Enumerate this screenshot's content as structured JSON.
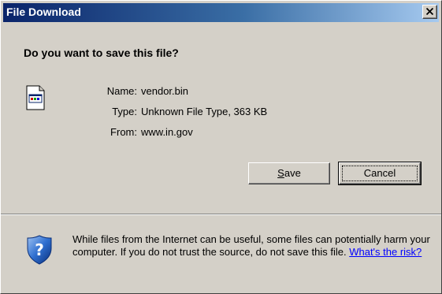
{
  "window": {
    "title": "File Download",
    "close_glyph": "×"
  },
  "dialog": {
    "question": "Do you want to save this file?",
    "file": {
      "icon": "unknown-file-icon",
      "fields": [
        {
          "label": "Name:",
          "value": "vendor.bin"
        },
        {
          "label": "Type:",
          "value": "Unknown File Type, 363 KB"
        },
        {
          "label": "From:",
          "value": "www.in.gov"
        }
      ]
    },
    "buttons": {
      "save": {
        "accel": "S",
        "rest": "ave"
      },
      "cancel": {
        "label": "Cancel"
      }
    },
    "warning": {
      "icon": "security-shield-icon",
      "text": "While files from the Internet can be useful, some files can potentially harm your computer. If you do not trust the source, do not save this file.",
      "link": "What's the risk?"
    }
  },
  "colors": {
    "title_gradient_start": "#0a246a",
    "title_gradient_end": "#a6caf0",
    "dialog_bg": "#d4d0c8",
    "link": "#0000ff"
  }
}
